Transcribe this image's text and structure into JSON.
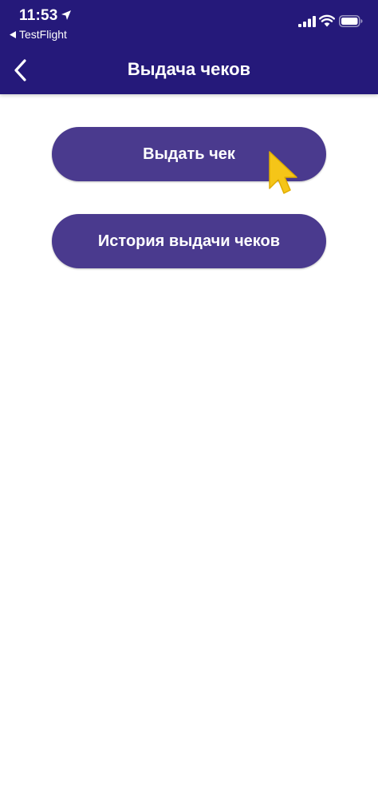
{
  "status_bar": {
    "time": "11:53",
    "back_app_label": "TestFlight"
  },
  "nav": {
    "title": "Выдача чеков"
  },
  "actions": {
    "issue_receipt_label": "Выдать чек",
    "history_label": "История выдачи чеков"
  },
  "colors": {
    "header": "#25197a",
    "button": "#4a3a8e",
    "cursor": "#f5c518"
  },
  "icons": [
    "location-arrow-icon",
    "back-triangle-icon",
    "signal-icon",
    "wifi-icon",
    "battery-icon",
    "chevron-left-icon",
    "pointer-cursor-icon"
  ]
}
